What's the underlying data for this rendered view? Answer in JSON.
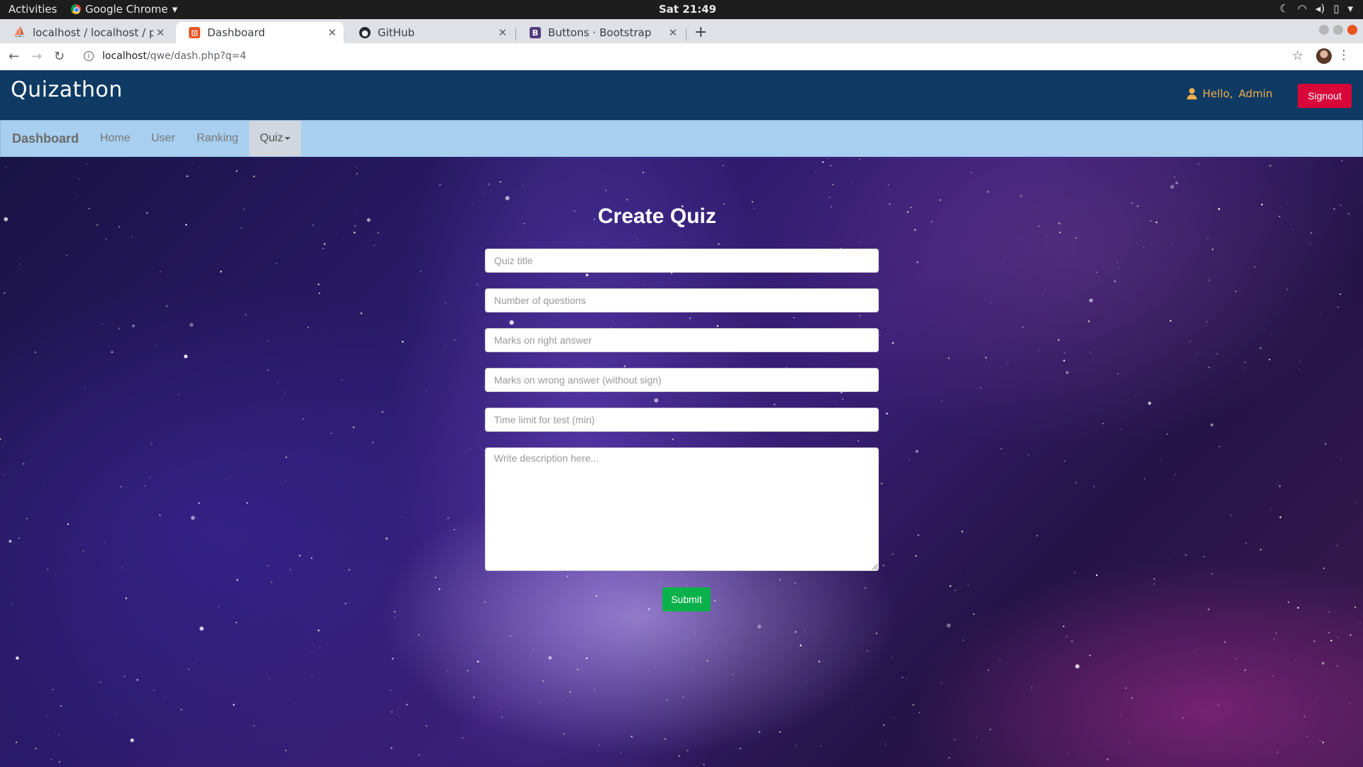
{
  "os": {
    "activities": "Activities",
    "app_name": "Google Chrome",
    "clock": "Sat 21:49"
  },
  "browser": {
    "tabs": [
      {
        "title": "localhost / localhost / pro",
        "favicon": "phpmyadmin-icon"
      },
      {
        "title": "Dashboard",
        "favicon": "dashboard-icon",
        "active": true
      },
      {
        "title": "GitHub",
        "favicon": "github-icon"
      },
      {
        "title": "Buttons · Bootstrap",
        "favicon": "bootstrap-icon"
      }
    ],
    "url_host": "localhost",
    "url_path": "/qwe/dash.php?q=4"
  },
  "header": {
    "logo": "Quizathon",
    "hello": "Hello,",
    "username": "Admin",
    "signout_label": "Signout",
    "accent": "#f0ad4e",
    "signout_color": "#d9063a"
  },
  "nav": {
    "brand": "Dashboard",
    "items": [
      "Home",
      "User",
      "Ranking",
      "Quiz"
    ]
  },
  "form": {
    "title": "Create Quiz",
    "placeholders": {
      "quiz_title": "Quiz title",
      "num_questions": "Number of questions",
      "marks_right": "Marks on right answer",
      "marks_wrong": "Marks on wrong answer (without sign)",
      "time_limit": "Time limit for test (min)",
      "description": "Write description here..."
    },
    "submit_label": "Submit",
    "submit_color": "#09b14a"
  }
}
